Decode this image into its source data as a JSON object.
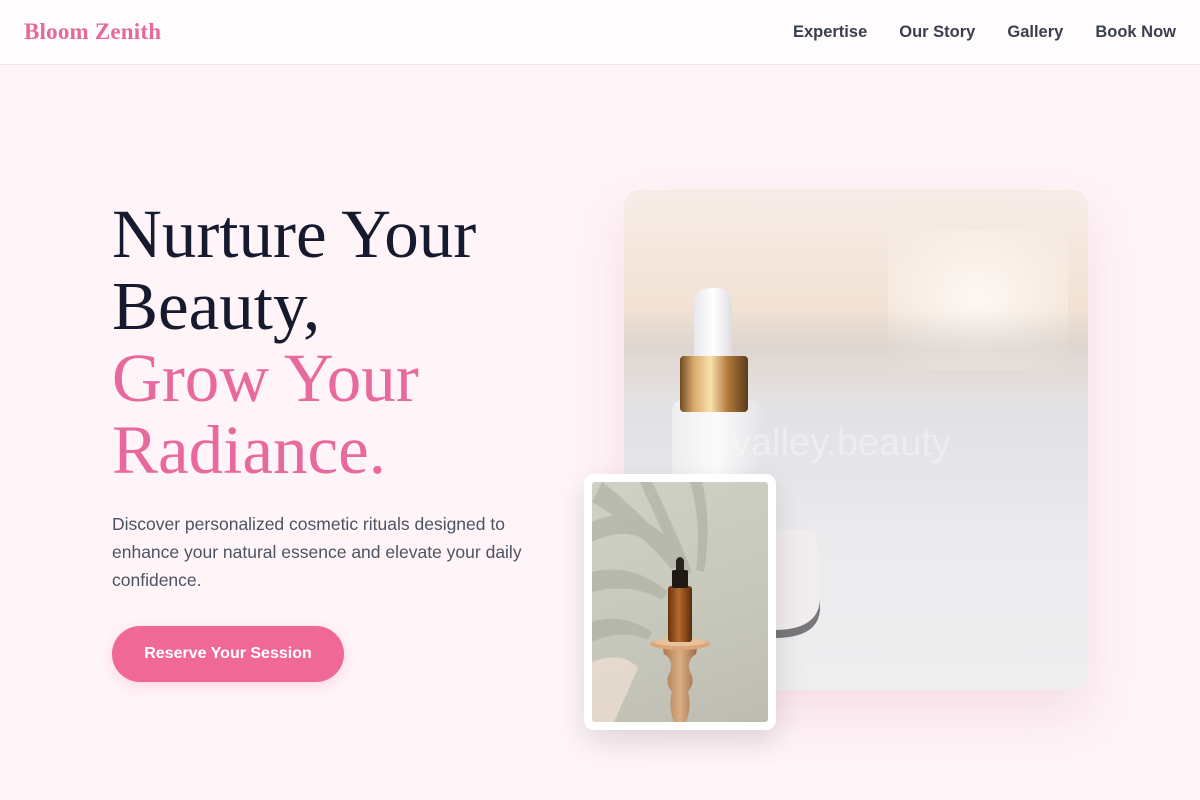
{
  "brand": {
    "name": "Bloom Zenith",
    "color": "#e56a9a"
  },
  "nav": {
    "items": [
      {
        "label": "Expertise"
      },
      {
        "label": "Our Story"
      },
      {
        "label": "Gallery"
      },
      {
        "label": "Book Now"
      }
    ]
  },
  "hero": {
    "title_lines": [
      "Nurture Your",
      "Beauty,"
    ],
    "accent_lines": [
      "Grow Your",
      "Radiance."
    ],
    "description": "Discover personalized cosmetic rituals designed to enhance your natural essence and elevate your daily confidence.",
    "cta_label": "Reserve Your Session"
  },
  "images": {
    "main_watermark": "valley.beauty",
    "main_subject": "white serum dropper bottle with gold collar",
    "inset_subject": "amber dropper bottle on wooden pedestal with palm leaf shadow"
  },
  "colors": {
    "accent": "#e8699b",
    "button": "#ef6896",
    "background": "#fff4f7",
    "heading": "#161a2e"
  }
}
